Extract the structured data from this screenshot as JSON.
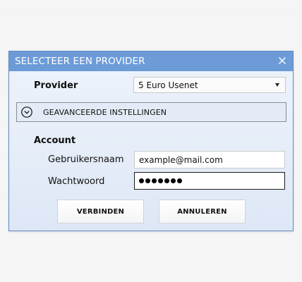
{
  "dialog": {
    "title": "SELECTEER EEN PROVIDER",
    "close_icon": "close-icon"
  },
  "provider": {
    "label": "Provider",
    "selected": "5 Euro Usenet"
  },
  "advanced": {
    "label": "GEAVANCEERDE INSTELLINGEN",
    "icon": "chevron-down-circle-icon"
  },
  "account": {
    "heading": "Account",
    "username_label": "Gebruikersnaam",
    "username_value": "example@mail.com",
    "password_label": "Wachtwoord",
    "password_masked": "•••••••"
  },
  "buttons": {
    "connect": "VERBINDEN",
    "cancel": "ANNULEREN"
  },
  "colors": {
    "titlebar": "#6c9bd8",
    "border": "#5e8cc4"
  }
}
